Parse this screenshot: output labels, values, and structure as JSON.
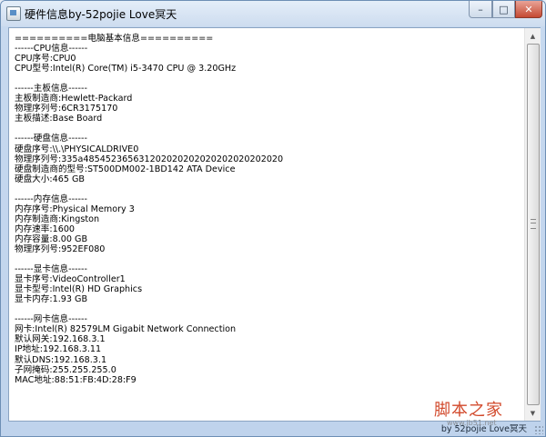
{
  "window": {
    "title": "硬件信息by-52pojie Love冥天",
    "controls": {
      "minimize": "–",
      "maximize": "□",
      "close": "✕"
    }
  },
  "report": {
    "lines": [
      "==========电脑基本信息==========",
      "------CPU信息------",
      "CPU序号:CPU0",
      "CPU型号:Intel(R) Core(TM) i5-3470 CPU @ 3.20GHz",
      "",
      "------主板信息------",
      "主板制造商:Hewlett-Packard",
      "物理序列号:6CR3175170",
      "主板描述:Base Board",
      "",
      "------硬盘信息------",
      "硬盘序号:\\\\.\\PHYSICALDRIVE0",
      "物理序列号:335a485452365631202020202020202020202020",
      "硬盘制造商的型号:ST500DM002-1BD142 ATA Device",
      "硬盘大小:465 GB",
      "",
      "------内存信息------",
      "内存序号:Physical Memory 3",
      "内存制造商:Kingston",
      "内存速率:1600",
      "内存容量:8.00 GB",
      "物理序列号:952EF080",
      "",
      "------显卡信息------",
      "显卡序号:VideoController1",
      "显卡型号:Intel(R) HD Graphics",
      "显卡内存:1.93 GB",
      "",
      "------网卡信息------",
      "网卡:Intel(R) 82579LM Gigabit Network Connection",
      "默认网关:192.168.3.1",
      "IP地址:192.168.3.11",
      "默认DNS:192.168.3.1",
      "子网掩码:255.255.255.0",
      "MAC地址:88:51:FB:4D:28:F9"
    ]
  },
  "statusbar": {
    "text": "by 52pojie Love冥天"
  },
  "watermark": {
    "text": "脚本之家",
    "url": "www.jb51.net"
  },
  "icons": {
    "scroll_up": "▲",
    "scroll_down": "▼"
  }
}
